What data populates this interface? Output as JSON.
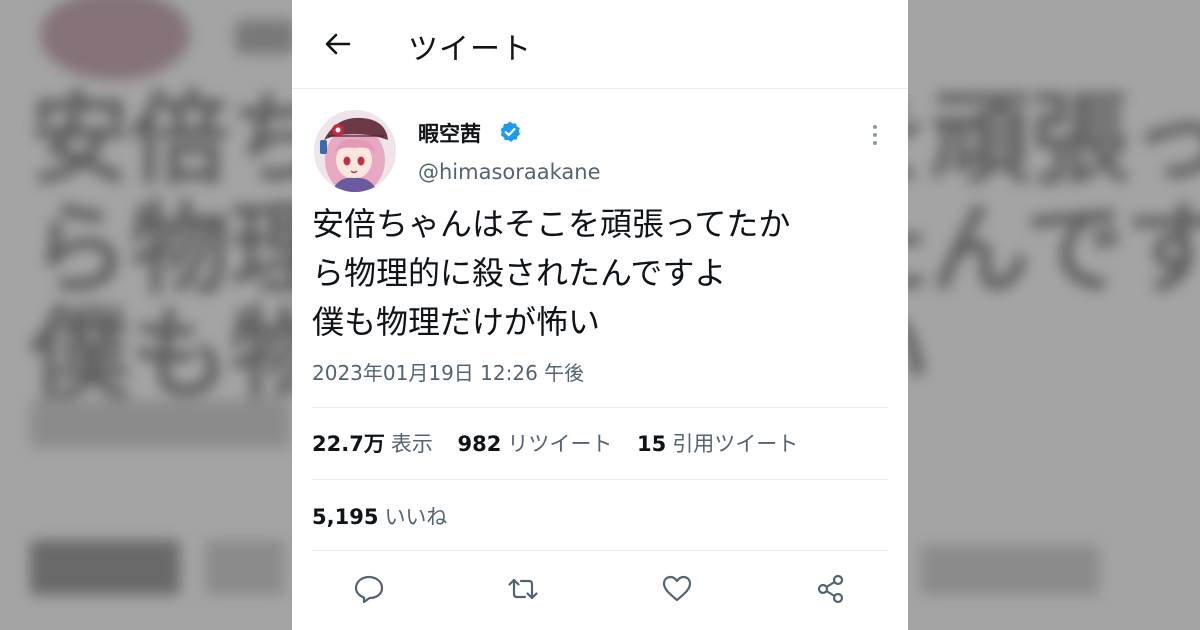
{
  "header": {
    "title": "ツイート"
  },
  "tweet": {
    "display_name": "暇空茜",
    "handle": "@himasoraakane",
    "verified": true,
    "text_lines": [
      "安倍ちゃんはそこを頑張ってたか",
      "ら物理的に殺されたんですよ",
      "僕も物理だけが怖い"
    ],
    "timestamp": "2023年01月19日 12:26 午後"
  },
  "stats": {
    "views_count": "22.7万",
    "views_label": "表示",
    "retweets_count": "982",
    "retweets_label": "リツイート",
    "quotes_count": "15",
    "quotes_label": "引用ツイート",
    "likes_count": "5,195",
    "likes_label": "いいね"
  },
  "icons": {
    "back": "back-arrow-icon",
    "verified": "verified-badge-icon",
    "more": "more-vertical-icon",
    "reply": "reply-icon",
    "retweet": "retweet-icon",
    "like": "heart-icon",
    "share": "share-icon"
  },
  "colors": {
    "text_primary": "#0f1419",
    "text_secondary": "#536471",
    "verified_blue": "#1d9bf0",
    "divider": "#e6ecf0",
    "background_blur": "#a4a4a4"
  }
}
